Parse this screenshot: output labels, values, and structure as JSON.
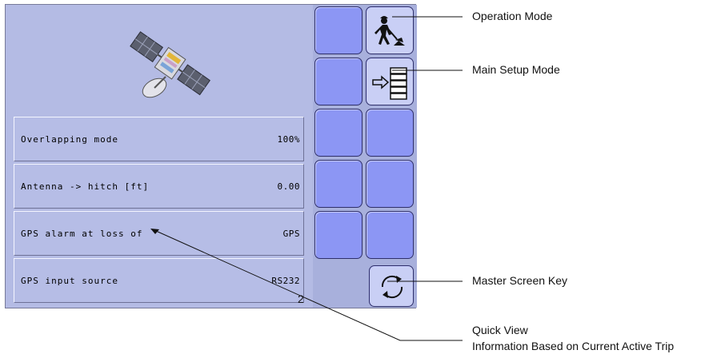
{
  "list": {
    "rows": [
      {
        "label": "Overlapping mode",
        "value": "100%"
      },
      {
        "label": "Antenna -> hitch [ft]",
        "value": "0.00"
      },
      {
        "label": "GPS alarm at loss of",
        "value": "GPS"
      },
      {
        "label": "GPS input source",
        "value": "RS232"
      }
    ]
  },
  "page_number": "2",
  "keys": {
    "operation_icon": "worker-shovel-icon",
    "setup_icon": "arrow-list-icon",
    "master_icon": "refresh-cycle-icon"
  },
  "callouts": {
    "operation_mode": "Operation Mode",
    "main_setup_mode": "Main Setup Mode",
    "master_screen_key": "Master Screen Key",
    "quick_view_line1": "Quick View",
    "quick_view_line2": "Information Based on Current Active Trip"
  },
  "colors": {
    "screen_bg": "#b4bbe4",
    "key_blue": "#8c96f4",
    "key_light": "#c9cff5"
  }
}
